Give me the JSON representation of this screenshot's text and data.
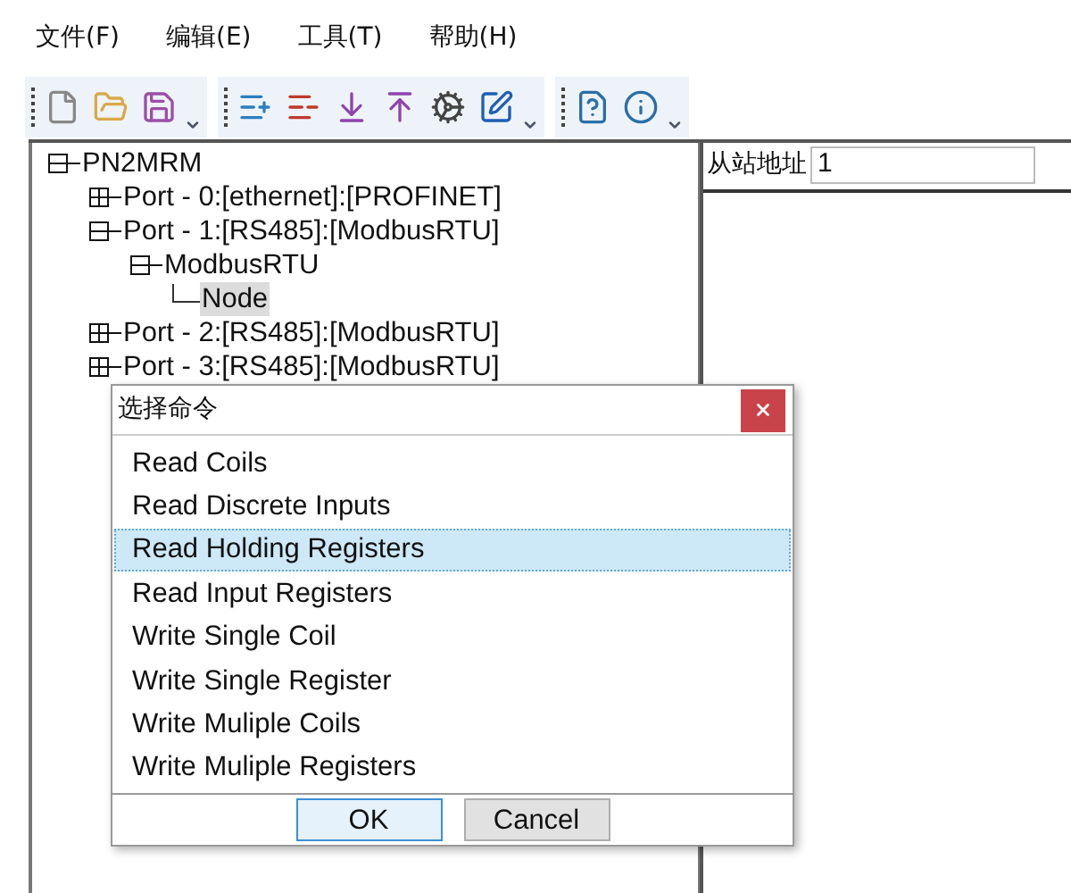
{
  "menu": [
    "文件(F)",
    "编辑(E)",
    "工具(T)",
    "帮助(H)"
  ],
  "tree": [
    {
      "label": "PN2MRM",
      "expanded": true,
      "selected": false,
      "children": [
        {
          "label": "Port - 0:[ethernet]:[PROFINET]",
          "expanded": false,
          "selected": false
        },
        {
          "label": "Port - 1:[RS485]:[ModbusRTU]",
          "expanded": true,
          "selected": false,
          "children": [
            {
              "label": "ModbusRTU",
              "expanded": true,
              "selected": false,
              "children": [
                {
                  "label": "Node",
                  "selected": true
                }
              ]
            }
          ]
        },
        {
          "label": "Port - 2:[RS485]:[ModbusRTU]",
          "expanded": false,
          "selected": false
        },
        {
          "label": "Port - 3:[RS485]:[ModbusRTU]",
          "expanded": false,
          "selected": false
        }
      ]
    }
  ],
  "slave_address": {
    "label": "从站地址",
    "value": "1"
  },
  "dialog": {
    "title": "选择命令",
    "items": [
      {
        "label": "Read Coils",
        "selected": false
      },
      {
        "label": "Read Discrete Inputs",
        "selected": false
      },
      {
        "label": "Read Holding Registers",
        "selected": true
      },
      {
        "label": "Read Input Registers",
        "selected": false
      },
      {
        "label": "Write Single Coil",
        "selected": false
      },
      {
        "label": "Write Single Register",
        "selected": false
      },
      {
        "label": "Write Muliple Coils",
        "selected": false
      },
      {
        "label": "Write Muliple Registers",
        "selected": false
      }
    ],
    "buttons": [
      {
        "label": "OK",
        "kind": "default"
      },
      {
        "label": "Cancel",
        "kind": "normal"
      }
    ]
  }
}
